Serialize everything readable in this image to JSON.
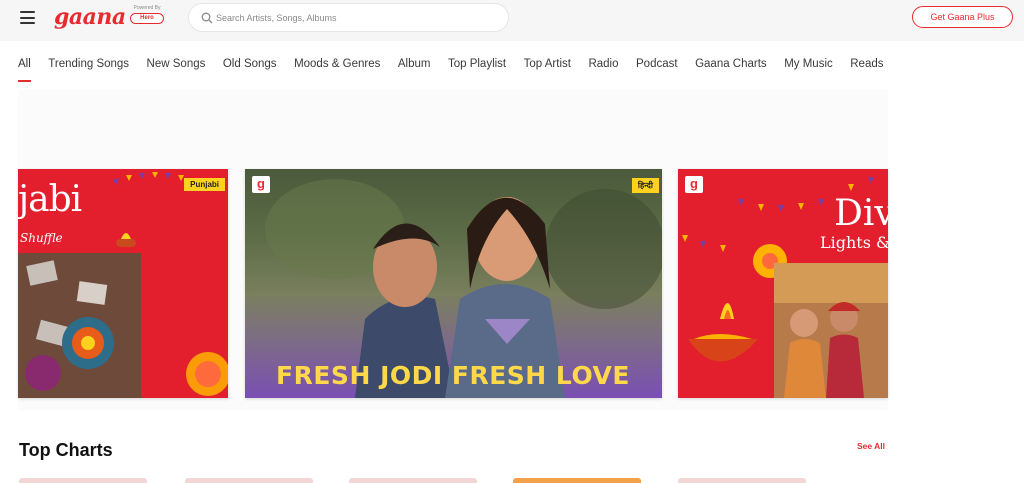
{
  "header": {
    "logo_text": "gaana",
    "powered_by_label": "Powered By",
    "powered_by_brand": "Hero",
    "search": {
      "placeholder": "Search Artists, Songs, Albums",
      "value": ""
    },
    "cta_label": "Get Gaana Plus"
  },
  "nav": {
    "tabs": [
      {
        "label": "All",
        "active": true
      },
      {
        "label": "Trending Songs"
      },
      {
        "label": "New Songs"
      },
      {
        "label": "Old Songs"
      },
      {
        "label": "Moods & Genres"
      },
      {
        "label": "Album"
      },
      {
        "label": "Top Playlist"
      },
      {
        "label": "Top Artist"
      },
      {
        "label": "Radio"
      },
      {
        "label": "Podcast"
      },
      {
        "label": "Gaana Charts"
      },
      {
        "label": "My Music"
      },
      {
        "label": "Reads"
      }
    ]
  },
  "carousel": {
    "cards": [
      {
        "title": "jabi",
        "subtitle": "Shuffle",
        "tag": "Punjabi"
      },
      {
        "headline": "FRESH JODI FRESH LOVE",
        "tag": "हिन्दी",
        "logo": "g"
      },
      {
        "title": "Div",
        "subtitle": "Lights &",
        "logo": "g"
      }
    ]
  },
  "section": {
    "title": "Top Charts",
    "see_all_label": "See All"
  },
  "colors": {
    "brand": "#e72c30",
    "tag_yellow": "#ffd21f",
    "headline_yellow": "#ffd84a"
  }
}
